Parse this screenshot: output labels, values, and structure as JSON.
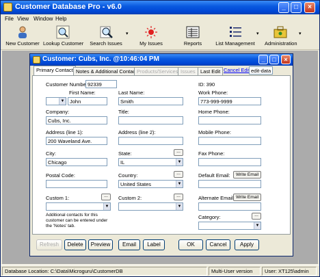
{
  "app": {
    "title": "Customer Database Pro - v6.0",
    "menu": [
      "File",
      "View",
      "Window",
      "Help"
    ],
    "toolbar": [
      {
        "label": "New Customer",
        "icon": "new-customer-icon"
      },
      {
        "label": "Lookup Customer",
        "icon": "lookup-icon"
      },
      {
        "label": "Search Issues",
        "icon": "search-icon"
      },
      {
        "label": "My Issues",
        "icon": "alert-light-icon"
      },
      {
        "label": "Reports",
        "icon": "report-icon"
      },
      {
        "label": "List Management",
        "icon": "list-icon"
      },
      {
        "label": "Administration",
        "icon": "admin-icon"
      }
    ],
    "dropdown_glyph": "▾",
    "status": {
      "location": "Database Location: C:\\Data\\Microguru\\CustomerDB",
      "mode": "Multi-User version",
      "user": "User: XT125\\admin"
    }
  },
  "customer": {
    "title": "Customer: Cubs, Inc. @10:46:04 PM",
    "tabs": [
      "Primary Contact",
      "Notes & Additional Contacts",
      "Products/Services",
      "Issues",
      "Last Edit"
    ],
    "links": {
      "cancel_edit": "Cancel Edit",
      "edit_data": "edit-data"
    },
    "fields": {
      "customer_number_label": "Customer Number:",
      "customer_number": "92339",
      "id_label": "ID: 390",
      "first_name_label": "First Name:",
      "first_name": "John",
      "last_name_label": "Last Name:",
      "last_name": "Smith",
      "work_phone_label": "Work Phone:",
      "work_phone": "773-999-9999",
      "company_label": "Company:",
      "company": "Cubs, Inc.",
      "title_label": "Title:",
      "title": "",
      "home_phone_label": "Home Phone:",
      "home_phone": "",
      "address1_label": "Address (line 1):",
      "address1": "200 Waveland Ave.",
      "address2_label": "Address (line 2):",
      "address2": "",
      "mobile_phone_label": "Mobile Phone:",
      "mobile_phone": "",
      "city_label": "City:",
      "city": "Chicago",
      "state_label": "State:",
      "state": "IL",
      "fax_phone_label": "Fax Phone:",
      "fax_phone": "",
      "postal_code_label": "Postal Code:",
      "postal_code": "",
      "country_label": "Country:",
      "country": "United States",
      "default_email_label": "Default Email:",
      "default_email": "",
      "custom1_label": "Custom 1:",
      "custom1": "",
      "custom2_label": "Custom 2:",
      "custom2": "",
      "alternate_email_label": "Alternate Email:",
      "alternate_email": "",
      "category_label": "Category:",
      "category": "",
      "write_email": "Write Email",
      "dots": "...",
      "note": "Additional contacts for this customer can be entered under the 'Notes' tab."
    },
    "buttons": {
      "refresh": "Refresh",
      "delete": "Delete",
      "preview": "Preview",
      "email": "Email",
      "label": "Label",
      "ok": "OK",
      "cancel": "Cancel",
      "apply": "Apply"
    }
  }
}
